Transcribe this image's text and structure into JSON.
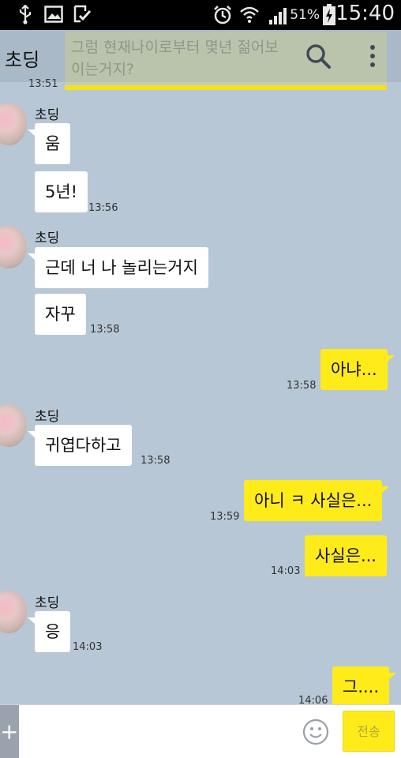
{
  "status_bar": {
    "battery_percent": "51%",
    "time": "15:40"
  },
  "header": {
    "title": "초딩",
    "pinned_message": "그럼 현재나이로부터 몇년 젊어보이는거지?",
    "pinned_time": "13:51"
  },
  "messages": [
    {
      "sender": "초딩",
      "text": "움",
      "time": ""
    },
    {
      "text": "5년!",
      "time": "13:56"
    },
    {
      "sender": "초딩",
      "text": "근데 너 나 놀리는거지",
      "time": ""
    },
    {
      "text": "자꾸",
      "time": "13:58"
    },
    {
      "text": "아냐...",
      "time": "13:58"
    },
    {
      "sender": "초딩",
      "text": "귀엽다하고",
      "time": "13:58"
    },
    {
      "text": "아니 ㅋ 사실은...",
      "time": "13:59"
    },
    {
      "text": "사실은...",
      "time": "14:03"
    },
    {
      "sender": "초딩",
      "text": "응",
      "time": "14:03"
    },
    {
      "text": "그....",
      "time": "14:06"
    }
  ],
  "input": {
    "plus": "+",
    "placeholder": "",
    "send_label": "전송"
  },
  "icons": [
    "usb-icon",
    "image-icon",
    "download-done-icon",
    "alarm-icon",
    "wifi-icon",
    "signal-icon",
    "battery-icon",
    "search-icon",
    "more-vertical-icon",
    "emoji-icon"
  ]
}
